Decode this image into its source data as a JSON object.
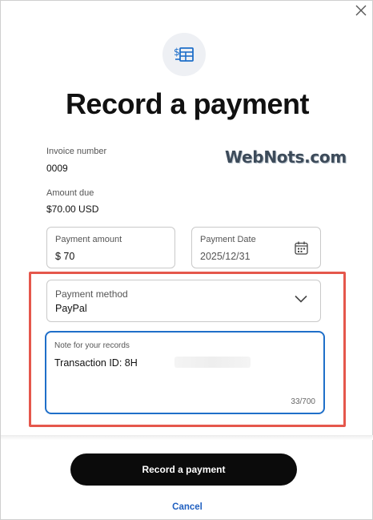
{
  "dialog": {
    "title": "Record a payment",
    "close_icon": "close-icon",
    "header_icon": "invoice-dollar-icon"
  },
  "invoice": {
    "number_label": "Invoice number",
    "number_value": "0009",
    "amount_due_label": "Amount due",
    "amount_due_value": "$70.00 USD"
  },
  "watermark": "WebNots.com",
  "fields": {
    "payment_amount": {
      "label": "Payment amount",
      "value": "$ 70"
    },
    "payment_date": {
      "label": "Payment Date",
      "value": "2025/12/31",
      "icon": "calendar-icon"
    },
    "payment_method": {
      "label": "Payment method",
      "value": "PayPal",
      "icon": "chevron-down-icon"
    },
    "note": {
      "label": "Note for your records",
      "value": "Transaction ID: 8H",
      "counter": "33/700"
    }
  },
  "actions": {
    "primary_label": "Record a payment",
    "cancel_label": "Cancel"
  },
  "colors": {
    "primary_button": "#0b0b0b",
    "link": "#1f5fc0",
    "focus_border": "#1f6fc9",
    "highlight_box": "#e5574c"
  }
}
